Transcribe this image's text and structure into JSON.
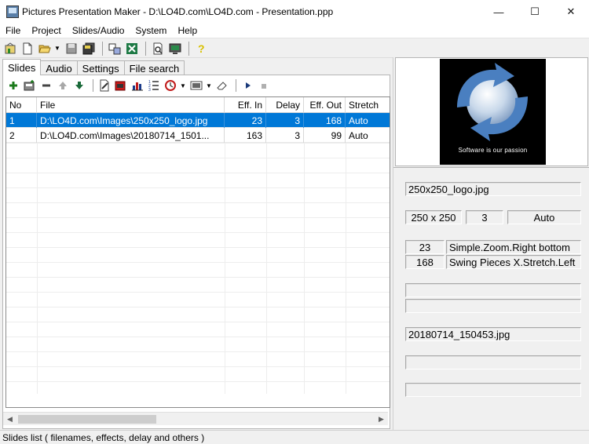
{
  "window": {
    "title": "Pictures Presentation Maker - D:\\LO4D.com\\LO4D.com - Presentation.ppp",
    "minimize": "—",
    "maximize": "☐",
    "close": "✕"
  },
  "menu": [
    "File",
    "Project",
    "Slides/Audio",
    "System",
    "Help"
  ],
  "tabs": [
    "Slides",
    "Audio",
    "Settings",
    "File search"
  ],
  "grid": {
    "headers": {
      "no": "No",
      "file": "File",
      "effin": "Eff. In",
      "delay": "Delay",
      "effout": "Eff. Out",
      "stretch": "Stretch"
    },
    "rows": [
      {
        "no": "1",
        "file": "D:\\LO4D.com\\Images\\250x250_logo.jpg",
        "effin": "23",
        "delay": "3",
        "effout": "168",
        "stretch": "Auto"
      },
      {
        "no": "2",
        "file": "D:\\LO4D.com\\Images\\20180714_1501...",
        "effin": "163",
        "delay": "3",
        "effout": "99",
        "stretch": "Auto"
      }
    ]
  },
  "preview": {
    "caption": "Software is our passion"
  },
  "details": {
    "file1_name": "250x250_logo.jpg",
    "file1_size": "250 x 250",
    "file1_delay": "3",
    "file1_stretch": "Auto",
    "effect_in_num": "23",
    "effect_in_name": "Simple.Zoom.Right bottom",
    "effect_out_num": "168",
    "effect_out_name": "Swing Pieces X.Stretch.Left",
    "file2_name": "20180714_150453.jpg"
  },
  "status": "Slides list ( filenames, effects, delay and others )",
  "colors": {
    "selection": "#0078d7",
    "preview_bg": "#000000",
    "logo_blue": "#4a7fc0"
  }
}
